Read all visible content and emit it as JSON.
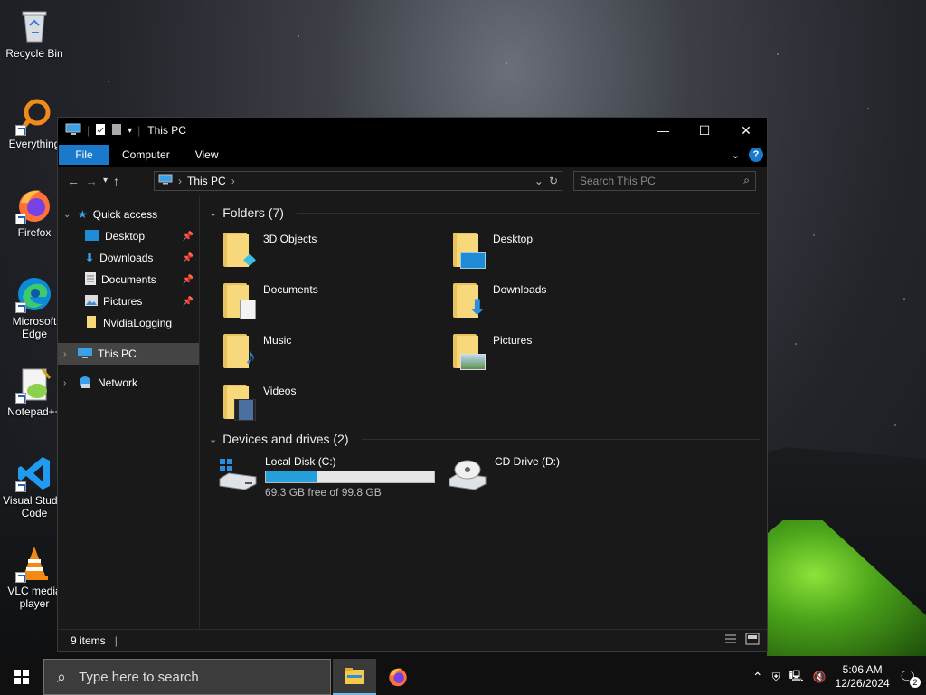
{
  "desktop": {
    "icons": [
      {
        "label": "Recycle Bin",
        "icon": "recycle-bin-icon"
      },
      {
        "label": "Everything",
        "icon": "everything-icon"
      },
      {
        "label": "Firefox",
        "icon": "firefox-icon"
      },
      {
        "label": "Microsoft Edge",
        "icon": "edge-icon"
      },
      {
        "label": "Notepad++",
        "icon": "notepadpp-icon"
      },
      {
        "label": "Visual Studio Code",
        "icon": "vscode-icon"
      },
      {
        "label": "VLC media player",
        "icon": "vlc-icon"
      }
    ]
  },
  "window": {
    "title": "This PC",
    "ribbon": {
      "file": "File",
      "computer": "Computer",
      "view": "View"
    },
    "address": {
      "crumb": "This PC"
    },
    "search": {
      "placeholder": "Search This PC"
    },
    "sidebar": {
      "quick_access": "Quick access",
      "items": [
        "Desktop",
        "Downloads",
        "Documents",
        "Pictures",
        "NvidiaLogging"
      ],
      "this_pc": "This PC",
      "network": "Network"
    },
    "folders_heading": "Folders (7)",
    "folders": [
      "3D Objects",
      "Desktop",
      "Documents",
      "Downloads",
      "Music",
      "Pictures",
      "Videos"
    ],
    "drives_heading": "Devices and drives (2)",
    "drives": [
      {
        "name": "Local Disk (C:)",
        "free": "69.3 GB free of 99.8 GB",
        "used_fraction": 0.306
      },
      {
        "name": "CD Drive (D:)"
      }
    ],
    "status": "9 items"
  },
  "taskbar": {
    "search_placeholder": "Type here to search",
    "time": "5:06 AM",
    "date": "12/26/2024",
    "notifications": "2"
  },
  "colors": {
    "accent": "#1979ca",
    "bar_fill": "#26a0da"
  }
}
